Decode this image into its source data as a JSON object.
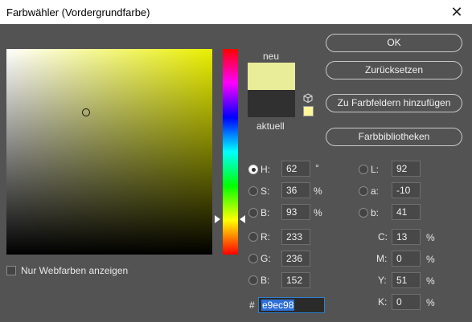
{
  "window": {
    "title": "Farbwähler (Vordergrundfarbe)",
    "close_symbol": "✕"
  },
  "colors": {
    "new": "#e9ec98",
    "current": "#303030",
    "hue_pure": "#eaef00",
    "accent": "#2f80d0"
  },
  "swatch": {
    "new_label": "neu",
    "current_label": "aktuell"
  },
  "buttons": {
    "ok": "OK",
    "reset": "Zurücksetzen",
    "add_to_swatches": "Zu Farbfeldern hinzufügen",
    "libraries": "Farbbibliotheken"
  },
  "hsb": {
    "h": {
      "label": "H:",
      "value": "62",
      "unit": "°"
    },
    "s": {
      "label": "S:",
      "value": "36",
      "unit": "%"
    },
    "b": {
      "label": "B:",
      "value": "93",
      "unit": "%"
    }
  },
  "rgb": {
    "r": {
      "label": "R:",
      "value": "233"
    },
    "g": {
      "label": "G:",
      "value": "236"
    },
    "b": {
      "label": "B:",
      "value": "152"
    }
  },
  "lab": {
    "l": {
      "label": "L:",
      "value": "92"
    },
    "a": {
      "label": "a:",
      "value": "-10"
    },
    "b": {
      "label": "b:",
      "value": "41"
    }
  },
  "cmyk": {
    "c": {
      "label": "C:",
      "value": "13",
      "unit": "%"
    },
    "m": {
      "label": "M:",
      "value": "0",
      "unit": "%"
    },
    "y": {
      "label": "Y:",
      "value": "51",
      "unit": "%"
    },
    "k": {
      "label": "K:",
      "value": "0",
      "unit": "%"
    }
  },
  "hex": {
    "label": "#",
    "value": "e9ec98"
  },
  "web_colors": {
    "label": "Nur Webfarben anzeigen",
    "checked": false
  }
}
